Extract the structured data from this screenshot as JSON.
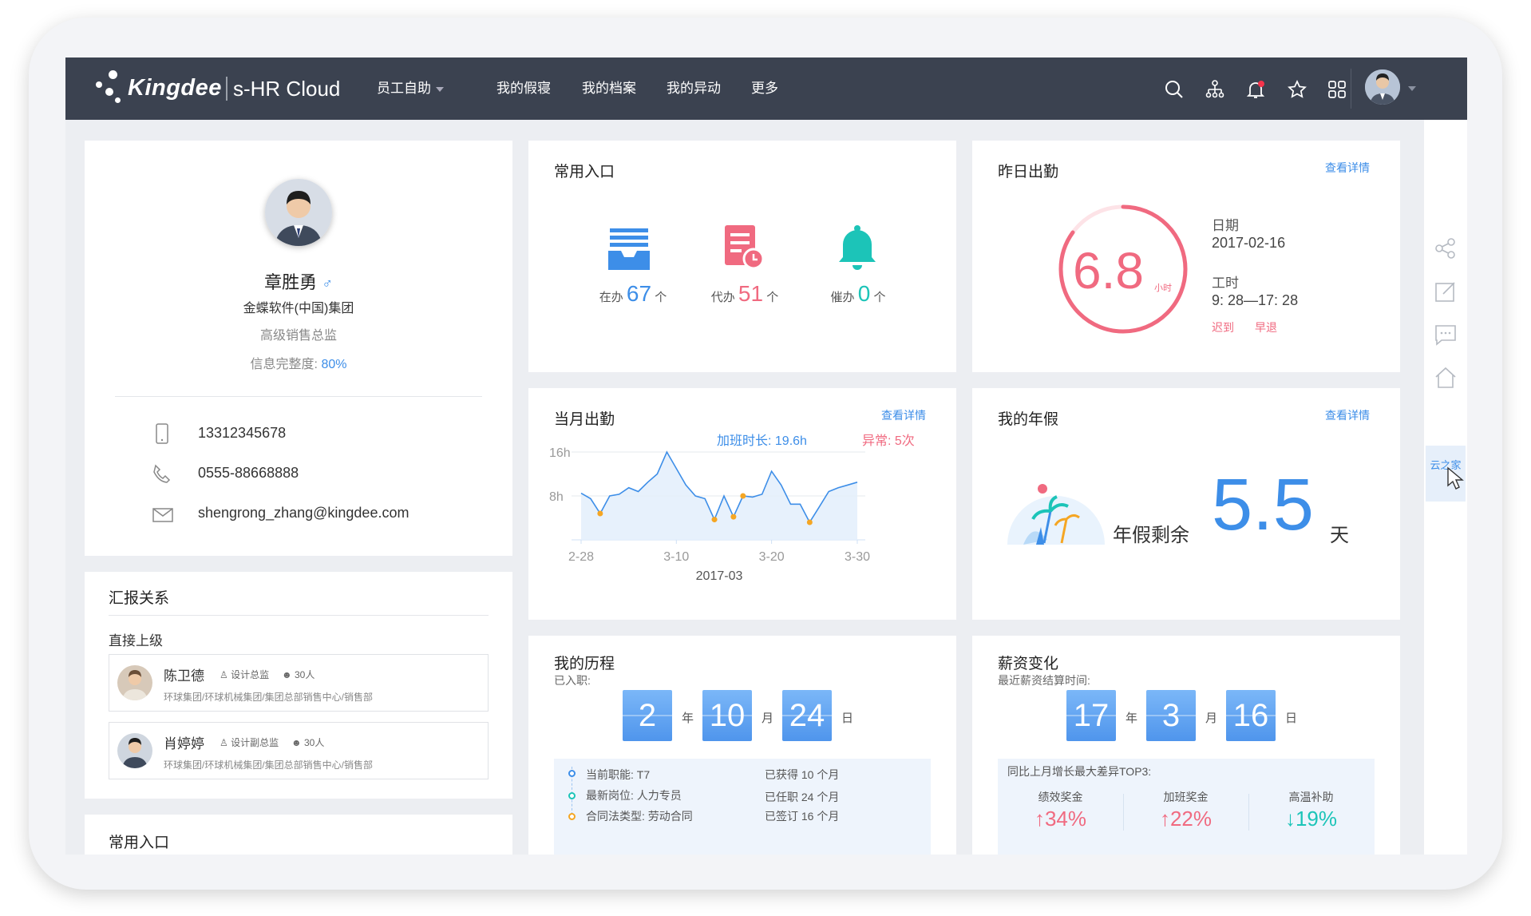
{
  "topbar": {
    "brand": "Kingdee",
    "product": "s-HR Cloud",
    "nav": [
      "员工自助",
      "我的假寝",
      "我的档案",
      "我的异动",
      "更多"
    ]
  },
  "profile": {
    "name": "章胜勇",
    "gender_icon": "male-icon",
    "company": "金蝶软件(中国)集团",
    "position": "高级销售总监",
    "completeness_label": "信息完整度:",
    "completeness_value": "80%",
    "mobile": "13312345678",
    "phone": "0555-88668888",
    "email": "shengrong_zhang@kingdee.com"
  },
  "report": {
    "title": "汇报关系",
    "subtitle": "直接上级",
    "people": [
      {
        "name": "陈卫德",
        "role": "设计总监",
        "count": "30人",
        "dept": "环球集团/环球机械集团/集团总部销售中心/销售部"
      },
      {
        "name": "肖婷婷",
        "role": "设计副总监",
        "count": "30人",
        "dept": "环球集团/环球机械集团/集团总部销售中心/销售部"
      }
    ]
  },
  "bottom_left": {
    "title": "常用入口"
  },
  "entry": {
    "title": "常用入口",
    "items": [
      {
        "label": "在办",
        "value": "67",
        "unit": "个",
        "color": "#3d8ee8"
      },
      {
        "label": "代办",
        "value": "51",
        "unit": "个",
        "color": "#f06a80"
      },
      {
        "label": "催办",
        "value": "0",
        "unit": "个",
        "color": "#1cc4b8"
      }
    ]
  },
  "yesterday": {
    "title": "昨日出勤",
    "more": "查看详情",
    "hours": "6.8",
    "hours_unit": "小时",
    "date_label": "日期",
    "date": "2017-02-16",
    "work_label": "工时",
    "work": "9: 28—17: 28",
    "late": "迟到",
    "early": "早退",
    "progress": 0.85
  },
  "month": {
    "title": "当月出勤",
    "more": "查看详情",
    "overtime": "加班时长: 19.6h",
    "abnormal": "异常: 5次",
    "period": "2017-03"
  },
  "chart_data": {
    "type": "area",
    "title": "当月出勤",
    "xlabel": "2017-03",
    "ylabel": "",
    "y_ticks": [
      "16h",
      "8h"
    ],
    "x_ticks": [
      "2-28",
      "3-10",
      "3-20",
      "3-30"
    ],
    "ylim": [
      0,
      16
    ],
    "grid": true,
    "x": [
      0,
      1,
      2,
      3,
      4,
      5,
      6,
      7,
      8,
      9,
      10,
      11,
      12,
      13,
      14,
      15,
      16,
      17,
      18,
      19,
      20,
      21,
      22,
      23,
      24,
      25,
      26,
      27,
      28,
      29
    ],
    "series": [
      {
        "values": [
          8.5,
          7.5,
          4.8,
          8,
          8.3,
          9.5,
          8.8,
          10.5,
          12,
          16,
          13,
          10,
          8,
          7.5,
          3.7,
          8,
          4.2,
          8,
          7.8,
          8.3,
          12.5,
          10,
          6.5,
          6.5,
          3.2,
          6,
          8.8,
          9.5,
          10,
          10.5
        ]
      }
    ],
    "abnormal_points": [
      2,
      14,
      16,
      17,
      24
    ]
  },
  "annual": {
    "title": "我的年假",
    "more": "查看详情",
    "label": "年假剩余",
    "value": "5.5",
    "unit": "天"
  },
  "history": {
    "title": "我的历程",
    "sub": "已入职:",
    "years": "2",
    "year_unit": "年",
    "months": "10",
    "month_unit": "月",
    "days": "24",
    "day_unit": "日",
    "rows": [
      {
        "left": "当前职能: T7",
        "right": "已获得  10 个月",
        "dot": "#3d8ee8"
      },
      {
        "left": "最新岗位: 人力专员",
        "right": "已任职  24 个月",
        "dot": "#1cc4b8"
      },
      {
        "left": "合同法类型: 劳动合同",
        "right": "已签订  16 个月",
        "dot": "#f5a623"
      }
    ]
  },
  "salary": {
    "title": "薪资变化",
    "sub": "最近薪资结算时间:",
    "d1": "17",
    "u1": "年",
    "d2": "3",
    "u2": "月",
    "d3": "16",
    "u3": "日",
    "top3_label": "同比上月增长最大差异TOP3:",
    "items": [
      {
        "label": "绩效奖金",
        "value": "↑34%",
        "color": "#f06a80"
      },
      {
        "label": "加班奖金",
        "value": "↑22%",
        "color": "#f06a80"
      },
      {
        "label": "高温补助",
        "value": "↓19%",
        "color": "#1cc4b8"
      }
    ]
  },
  "sidebar": {
    "yunzhijia": "云之家"
  }
}
